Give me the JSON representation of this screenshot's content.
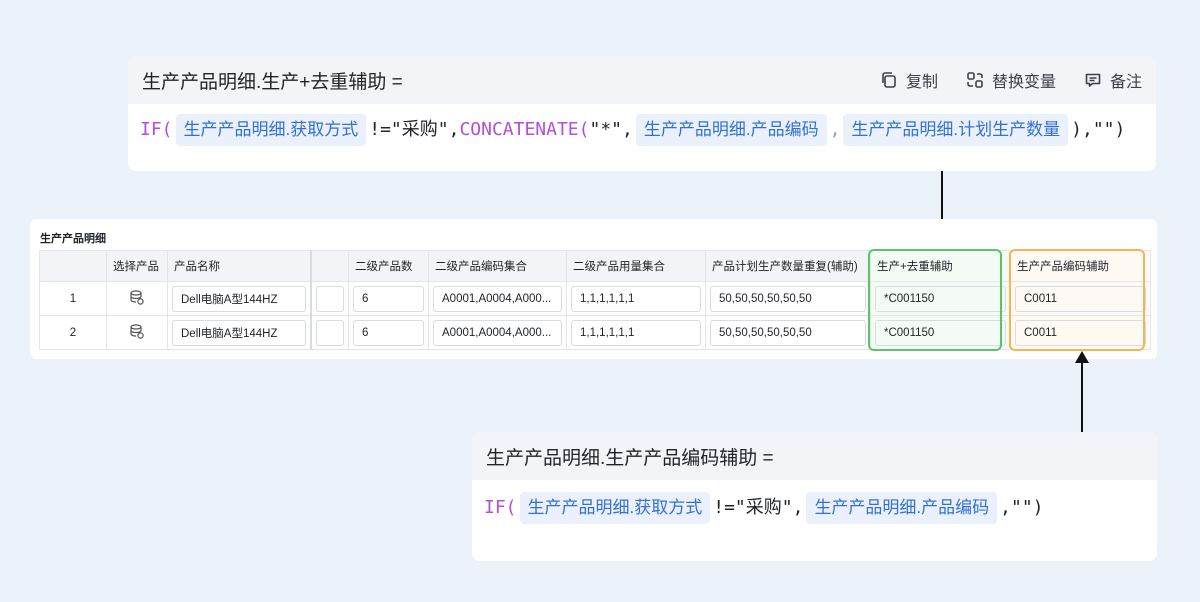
{
  "formula_top": {
    "title": "生产产品明细.生产+去重辅助 =",
    "actions": {
      "copy": "复制",
      "replace": "替换变量",
      "note": "备注"
    },
    "parts": {
      "fn_if": "IF(",
      "t1": "生产产品明细.获取方式",
      "op1": "!=\"采购\",",
      "fn_concat": "CONCATENATE(",
      "s1": "\"*\",",
      "t2": "生产产品明细.产品编码",
      "c1": ",",
      "t3": "生产产品明细.计划生产数量",
      "end": "),\"\")"
    }
  },
  "formula_bottom": {
    "title": "生产产品明细.生产产品编码辅助 =",
    "parts": {
      "fn_if": "IF(",
      "t1": "生产产品明细.获取方式",
      "op1": "!=\"采购\",",
      "t2": "生产产品明细.产品编码",
      "end": ",\"\")"
    }
  },
  "table": {
    "title": "生产产品明细",
    "headers": {
      "select": "选择产品",
      "name": "产品名称",
      "sub_count": "二级产品数",
      "sub_codes": "二级产品编码集合",
      "sub_usage": "二级产品用量集合",
      "plan_repeat": "产品计划生产数量重复(辅助)",
      "dedupe": "生产+去重辅助",
      "code_aux": "生产产品编码辅助"
    },
    "rows": [
      {
        "index": "1",
        "name": "Dell电脑A型144HZ",
        "sub_count": "6",
        "sub_codes": "A0001,A0004,A000...",
        "sub_usage": "1,1,1,1,1,1",
        "plan_repeat": "50,50,50,50,50,50",
        "dedupe": "*C001150",
        "code_aux": "C0011"
      },
      {
        "index": "2",
        "name": "Dell电脑A型144HZ",
        "sub_count": "6",
        "sub_codes": "A0001,A0004,A000...",
        "sub_usage": "1,1,1,1,1,1",
        "plan_repeat": "50,50,50,50,50,50",
        "dedupe": "*C001150",
        "code_aux": "C0011"
      }
    ]
  },
  "colors": {
    "green": "#5cc26e",
    "orange": "#f5b35a",
    "token_bg": "#eaf1fd",
    "token_text": "#3370d6",
    "fn": "#b34fd6"
  },
  "icons": {
    "copy": "copy-icon",
    "replace": "replace-variable-icon",
    "note": "note-icon",
    "select": "database-select-icon"
  }
}
